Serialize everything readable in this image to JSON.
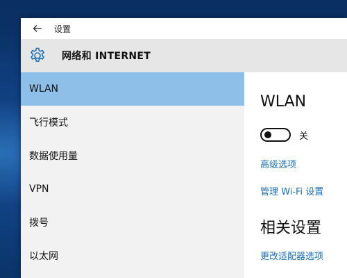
{
  "window": {
    "title": "设置"
  },
  "header": {
    "title": "网络和 INTERNET",
    "icon": "gear-icon"
  },
  "sidebar": {
    "items": [
      {
        "label": "WLAN",
        "selected": true
      },
      {
        "label": "飞行模式",
        "selected": false
      },
      {
        "label": "数据使用量",
        "selected": false
      },
      {
        "label": "VPN",
        "selected": false
      },
      {
        "label": "拨号",
        "selected": false
      },
      {
        "label": "以太网",
        "selected": false
      }
    ]
  },
  "content": {
    "title": "WLAN",
    "toggle": {
      "state": "off",
      "label": "关"
    },
    "links": {
      "advanced": "高级选项",
      "manage_wifi": "管理 Wi-Fi 设置"
    },
    "related_title": "相关设置",
    "related_links": {
      "adapter": "更改适配器选项"
    }
  },
  "colors": {
    "accent_selected": "#8dbfe8",
    "link": "#1a6fb8",
    "header_bg": "#e6e6e6",
    "sidebar_bg": "#f2f2f2"
  }
}
